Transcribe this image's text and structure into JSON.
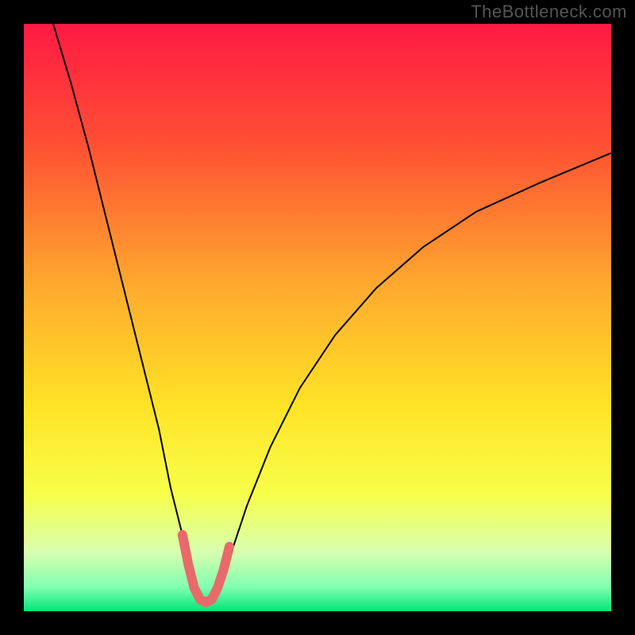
{
  "watermark": "TheBottleneck.com",
  "chart_data": {
    "type": "line",
    "title": "",
    "xlabel": "",
    "ylabel": "",
    "xlim": [
      0,
      100
    ],
    "ylim": [
      0,
      100
    ],
    "gradient_stops": [
      {
        "offset": 0,
        "color": "#ff1a44"
      },
      {
        "offset": 20,
        "color": "#ff4e33"
      },
      {
        "offset": 45,
        "color": "#ffab2e"
      },
      {
        "offset": 65,
        "color": "#ffe326"
      },
      {
        "offset": 80,
        "color": "#f7ff4a"
      },
      {
        "offset": 90,
        "color": "#d8ffb0"
      },
      {
        "offset": 96,
        "color": "#7fffb0"
      },
      {
        "offset": 100,
        "color": "#00e676"
      }
    ],
    "series": [
      {
        "name": "curve-left",
        "stroke": "#000000",
        "stroke_width": 2,
        "x": [
          5,
          8,
          11,
          14,
          17,
          20,
          23,
          25,
          27,
          28.5,
          29.5
        ],
        "y": [
          100,
          90,
          79,
          67,
          55,
          43,
          31,
          21,
          13,
          7,
          3
        ]
      },
      {
        "name": "curve-right",
        "stroke": "#000000",
        "stroke_width": 2,
        "x": [
          33,
          35,
          38,
          42,
          47,
          53,
          60,
          68,
          77,
          88,
          100
        ],
        "y": [
          3,
          9,
          18,
          28,
          38,
          47,
          55,
          62,
          68,
          73,
          78
        ]
      },
      {
        "name": "valley-highlight",
        "stroke": "#e86a6a",
        "stroke_width": 12,
        "linecap": "round",
        "x": [
          27,
          28,
          29,
          30,
          31,
          32,
          33,
          34,
          35
        ],
        "y": [
          13,
          8,
          4,
          2,
          1.5,
          2,
          4,
          7,
          11
        ]
      }
    ]
  }
}
